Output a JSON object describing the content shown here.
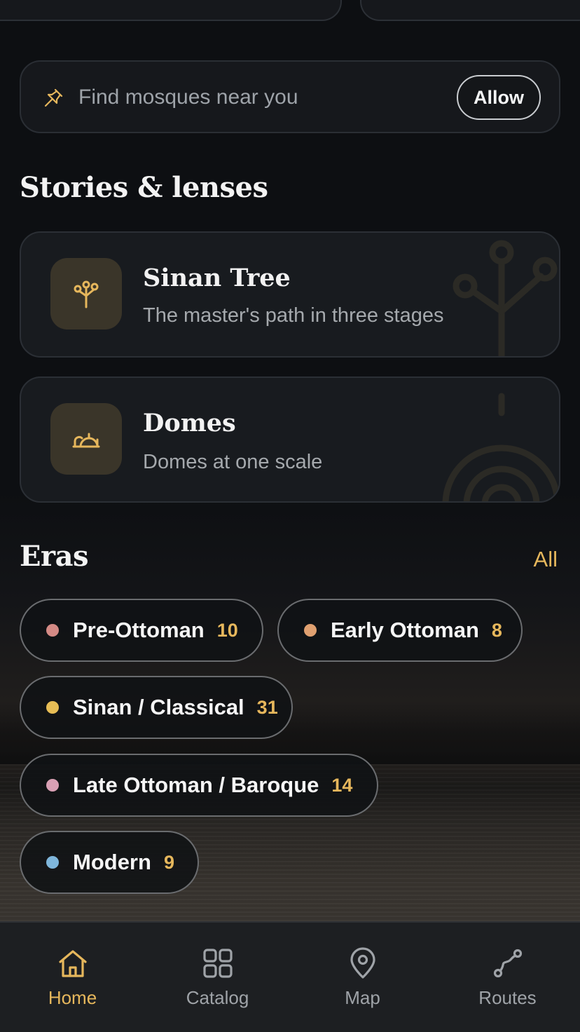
{
  "location_banner": {
    "text": "Find mosques near you",
    "allow_label": "Allow"
  },
  "stories": {
    "title": "Stories & lenses",
    "cards": [
      {
        "title": "Sinan Tree",
        "subtitle": "The master's path in three stages",
        "icon": "tree-icon"
      },
      {
        "title": "Domes",
        "subtitle": "Domes at one scale",
        "icon": "dome-icon"
      }
    ]
  },
  "eras": {
    "title": "Eras",
    "all_label": "All",
    "items": [
      {
        "label": "Pre-Ottoman",
        "count": "10",
        "color": "#d48a85"
      },
      {
        "label": "Early Ottoman",
        "count": "8",
        "color": "#e0a070"
      },
      {
        "label": "Sinan / Classical",
        "count": "31",
        "color": "#e7bd55"
      },
      {
        "label": "Late Ottoman / Baroque",
        "count": "14",
        "color": "#d9a0b4"
      },
      {
        "label": "Modern",
        "count": "9",
        "color": "#7fb6db"
      }
    ]
  },
  "nav": {
    "items": [
      {
        "label": "Home",
        "icon": "home-icon",
        "active": true
      },
      {
        "label": "Catalog",
        "icon": "grid-icon",
        "active": false
      },
      {
        "label": "Map",
        "icon": "map-pin-icon",
        "active": false
      },
      {
        "label": "Routes",
        "icon": "route-icon",
        "active": false
      }
    ]
  },
  "colors": {
    "accent": "#e6b75c",
    "background": "#0d0f12",
    "card": "#181b1f"
  }
}
